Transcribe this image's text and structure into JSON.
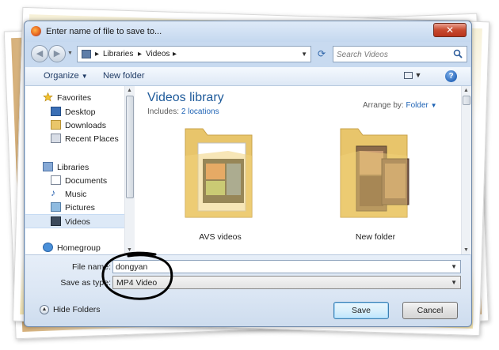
{
  "window": {
    "title": "Enter name of file to save to..."
  },
  "address_bar": {
    "crumbs": [
      "Libraries",
      "Videos"
    ]
  },
  "search": {
    "placeholder": "Search Videos"
  },
  "toolbar": {
    "organize_label": "Organize",
    "new_folder_label": "New folder"
  },
  "nav_pane": {
    "favorites": [
      "Favorites",
      "Desktop",
      "Downloads",
      "Recent Places"
    ],
    "libraries": [
      "Libraries",
      "Documents",
      "Music",
      "Pictures",
      "Videos"
    ],
    "homegroup": "Homegroup"
  },
  "library": {
    "title": "Videos library",
    "includes_label": "Includes:",
    "includes_link": "2 locations",
    "arrange_label": "Arrange by:",
    "arrange_value": "Folder"
  },
  "folders": [
    {
      "name": "AVS videos"
    },
    {
      "name": "New folder"
    }
  ],
  "form": {
    "file_name_label": "File name:",
    "file_name_value": "dongyan",
    "save_as_label": "Save as type:",
    "save_as_value": "MP4 Video"
  },
  "footer": {
    "hide_folders_label": "Hide Folders",
    "save_label": "Save",
    "cancel_label": "Cancel"
  },
  "colors": {
    "accent": "#1e5a9a",
    "link": "#1e63b5",
    "chrome": "#c8daf0",
    "close": "#c7492e"
  }
}
